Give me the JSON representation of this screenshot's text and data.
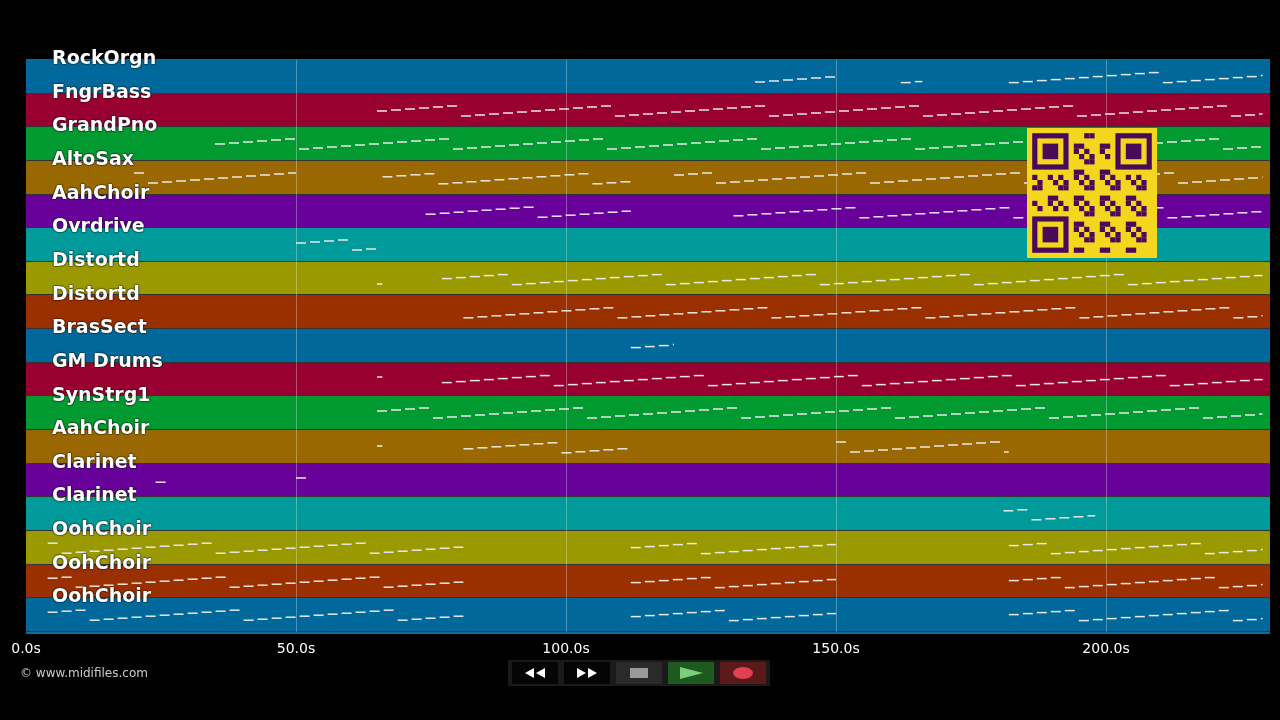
{
  "tracks": [
    {
      "name": "RockOrgn",
      "color": "#00689a"
    },
    {
      "name": "FngrBass",
      "color": "#990032"
    },
    {
      "name": "GrandPno",
      "color": "#009a30"
    },
    {
      "name": "AltoSax",
      "color": "#9a6800"
    },
    {
      "name": "AahChoir",
      "color": "#68009a"
    },
    {
      "name": "Ovrdrive",
      "color": "#009a9a"
    },
    {
      "name": "Distortd",
      "color": "#9a9a00"
    },
    {
      "name": "Distortd",
      "color": "#9a3000"
    },
    {
      "name": "BrasSect",
      "color": "#00689a"
    },
    {
      "name": "GM Drums",
      "color": "#990032"
    },
    {
      "name": "SynStrg1",
      "color": "#009a30"
    },
    {
      "name": "AahChoir",
      "color": "#9a6800"
    },
    {
      "name": "Clarinet",
      "color": "#68009a"
    },
    {
      "name": "Clarinet",
      "color": "#009a9a"
    },
    {
      "name": "OohChoir",
      "color": "#9a9a00"
    },
    {
      "name": "OohChoir",
      "color": "#9a3000"
    },
    {
      "name": "OohChoir",
      "color": "#00689a"
    }
  ],
  "time_axis": [
    "0.0s",
    "50.0s",
    "100.0s",
    "150.0s",
    "200.0s"
  ],
  "credit": "© www.midifiles.com",
  "controls": [
    {
      "kind": "rewind"
    },
    {
      "kind": "forward"
    },
    {
      "kind": "stop"
    },
    {
      "kind": "play"
    },
    {
      "kind": "record"
    }
  ]
}
